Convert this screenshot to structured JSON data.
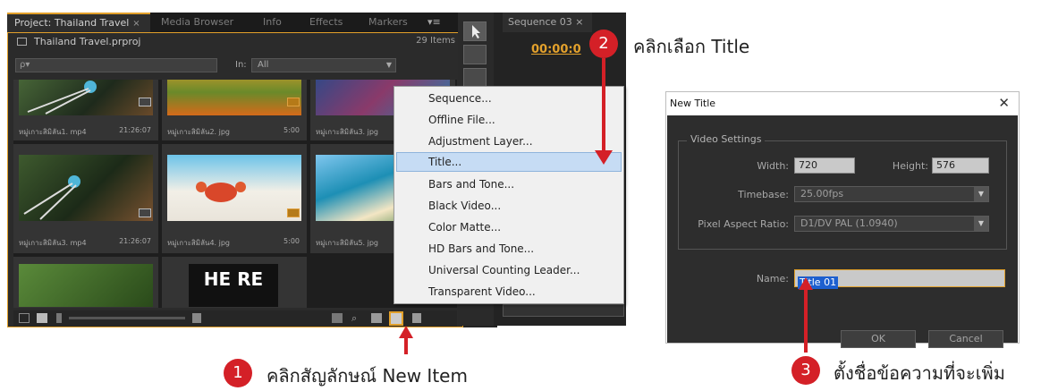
{
  "project_panel": {
    "tabs": [
      {
        "label": "Project: Thailand Travel",
        "close": "×"
      },
      {
        "label": "Media Browser"
      },
      {
        "label": "Info"
      },
      {
        "label": "Effects"
      },
      {
        "label": "Markers"
      }
    ],
    "project_file": "Thailand Travel.prproj",
    "item_count": "29 Items",
    "search_placeholder": "ρ▾",
    "in_label": "In:",
    "in_value": "All",
    "items": [
      {
        "name": "หมู่เกาะสิมิลัน1. mp4",
        "duration": "21:26:07"
      },
      {
        "name": "หมู่เกาะสิมิลัน2. jpg",
        "duration": "5:00"
      },
      {
        "name": "หมู่เกาะสิมิลัน3. jpg",
        "duration": ""
      },
      {
        "name": "หมู่เกาะสิมิลัน3. mp4",
        "duration": "21:26:07"
      },
      {
        "name": "หมู่เกาะสิมิลัน4. jpg",
        "duration": "5:00"
      },
      {
        "name": "หมู่เกาะสิมิลัน5. jpg",
        "duration": ""
      }
    ],
    "here_text": "HE RE"
  },
  "context_menu": {
    "items": [
      "Sequence...",
      "Offline File...",
      "Adjustment Layer...",
      "Title...",
      "Bars and Tone...",
      "Black Video...",
      "Color Matte...",
      "HD Bars and Tone...",
      "Universal Counting Leader...",
      "Transparent Video..."
    ],
    "highlighted_index": 3
  },
  "sequence_panel": {
    "tab": "Sequence 03",
    "close": "×",
    "timecode": "00:00:0"
  },
  "annotations": [
    {
      "number": "1",
      "text": "คลิกสัญลักษณ์ New Item"
    },
    {
      "number": "2",
      "text": "คลิกเลือก Title"
    },
    {
      "number": "3",
      "text": "ตั้งชื่อข้อความที่จะเพิ่ม"
    }
  ],
  "new_title_dialog": {
    "title": "New Title",
    "close": "✕",
    "group_label": "Video Settings",
    "width_label": "Width:",
    "width_value": "720",
    "height_label": "Height:",
    "height_value": "576",
    "timebase_label": "Timebase:",
    "timebase_value": "25.00fps",
    "par_label": "Pixel Aspect Ratio:",
    "par_value": "D1/DV PAL (1.0940)",
    "name_label": "Name:",
    "name_value": "Title 01",
    "ok_label": "OK",
    "cancel_label": "Cancel"
  },
  "colors": {
    "accent": "#e2a02a",
    "annotation_red": "#d42027",
    "menu_highlight": "#c6dcf4"
  }
}
